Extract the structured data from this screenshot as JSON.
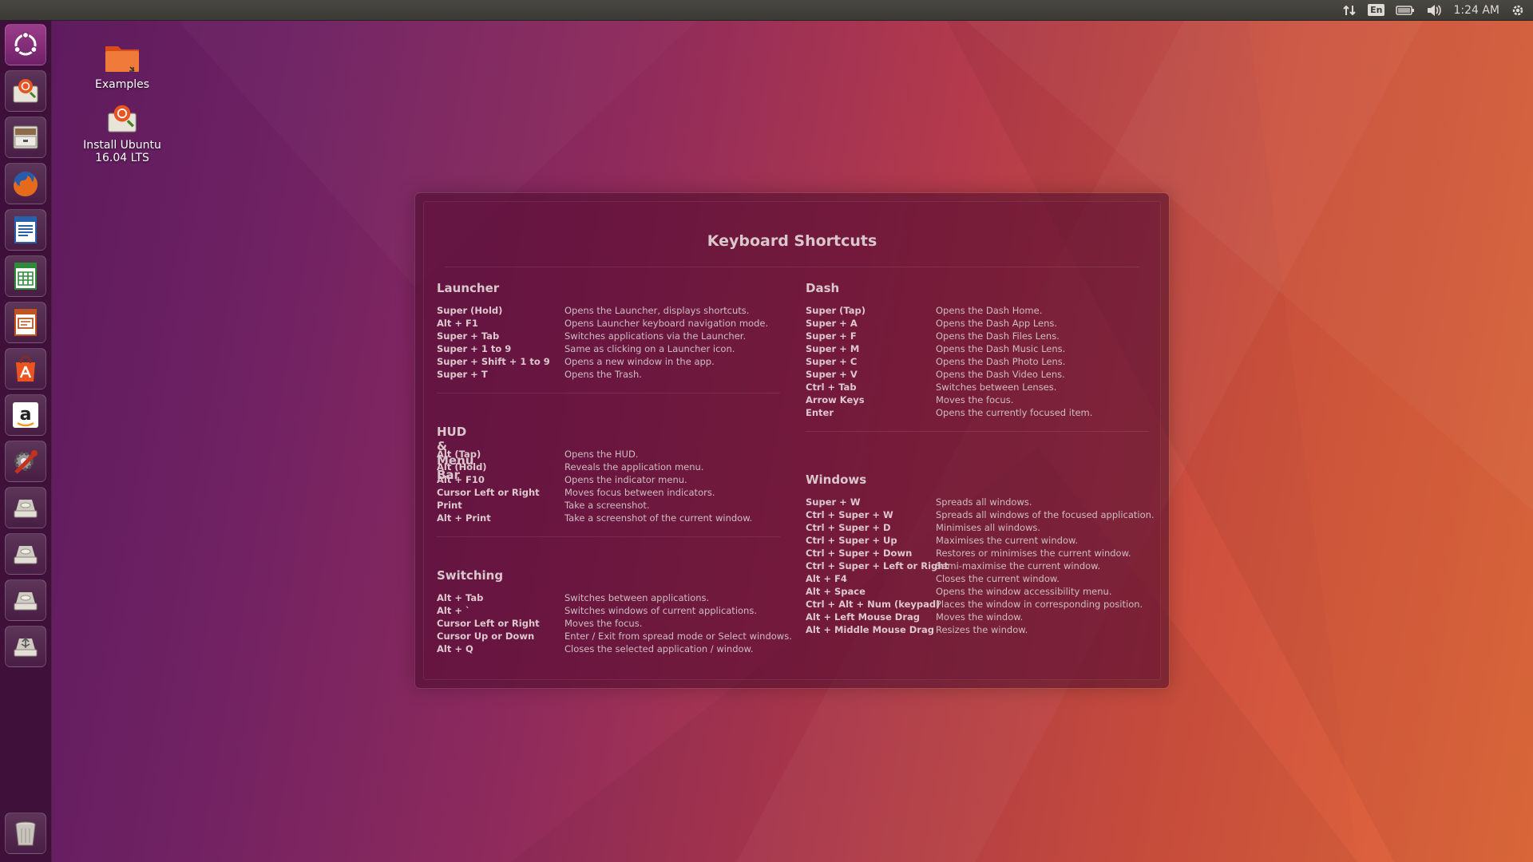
{
  "top_panel": {
    "keyboard_layout": "En",
    "clock": "1:24 AM"
  },
  "launcher": {
    "items": [
      {
        "name": "dash-home",
        "icon": "ubuntu-logo-icon"
      },
      {
        "name": "install-ubuntu",
        "icon": "installer-icon"
      },
      {
        "name": "files",
        "icon": "file-cabinet-icon"
      },
      {
        "name": "firefox",
        "icon": "firefox-icon"
      },
      {
        "name": "libreoffice-writer",
        "icon": "writer-icon"
      },
      {
        "name": "libreoffice-calc",
        "icon": "calc-icon"
      },
      {
        "name": "libreoffice-impress",
        "icon": "impress-icon"
      },
      {
        "name": "ubuntu-software",
        "icon": "software-center-icon"
      },
      {
        "name": "amazon",
        "icon": "amazon-icon"
      },
      {
        "name": "system-settings",
        "icon": "settings-icon"
      },
      {
        "name": "drive-1",
        "icon": "drive-icon"
      },
      {
        "name": "drive-2",
        "icon": "drive-icon"
      },
      {
        "name": "drive-3",
        "icon": "drive-icon"
      },
      {
        "name": "usb-drive",
        "icon": "usb-drive-icon"
      },
      {
        "name": "trash",
        "icon": "trash-icon"
      }
    ]
  },
  "desktop": {
    "icons": [
      {
        "label": "Examples",
        "icon": "folder-icon"
      },
      {
        "label": "Install Ubuntu 16.04 LTS",
        "icon": "installer-icon"
      }
    ]
  },
  "overlay": {
    "title": "Keyboard Shortcuts",
    "columns": [
      {
        "sections": [
          {
            "title": "Launcher",
            "rows": [
              {
                "key": "Super (Hold)",
                "desc": "Opens the Launcher, displays shortcuts."
              },
              {
                "key": "Alt + F1",
                "desc": "Opens Launcher keyboard navigation mode."
              },
              {
                "key": "Super + Tab",
                "desc": "Switches applications via the Launcher."
              },
              {
                "key": "Super + 1 to 9",
                "desc": "Same as clicking on a Launcher icon."
              },
              {
                "key": "Super + Shift + 1 to 9",
                "desc": "Opens a new window in the app."
              },
              {
                "key": "Super + T",
                "desc": "Opens the Trash."
              }
            ]
          },
          {
            "title": "HUD & Menu Bar",
            "rows": [
              {
                "key": "Alt (Tap)",
                "desc": "Opens the HUD."
              },
              {
                "key": "Alt (Hold)",
                "desc": "Reveals the application menu."
              },
              {
                "key": "Alt + F10",
                "desc": "Opens the indicator menu."
              },
              {
                "key": "Cursor Left or Right",
                "desc": "Moves focus between indicators."
              },
              {
                "key": "Print",
                "desc": "Take a screenshot."
              },
              {
                "key": "Alt + Print",
                "desc": "Take a screenshot of the current window."
              }
            ]
          },
          {
            "title": "Switching",
            "rows": [
              {
                "key": "Alt + Tab",
                "desc": "Switches between applications."
              },
              {
                "key": "Alt + `",
                "desc": "Switches windows of current applications."
              },
              {
                "key": "Cursor Left or Right",
                "desc": "Moves the focus."
              },
              {
                "key": "Cursor Up or Down",
                "desc": "Enter / Exit from spread mode or Select windows."
              },
              {
                "key": "Alt + Q",
                "desc": "Closes the selected application / window."
              }
            ]
          }
        ]
      },
      {
        "sections": [
          {
            "title": "Dash",
            "rows": [
              {
                "key": "Super (Tap)",
                "desc": "Opens the Dash Home."
              },
              {
                "key": "Super + A",
                "desc": "Opens the Dash App Lens."
              },
              {
                "key": "Super + F",
                "desc": "Opens the Dash Files Lens."
              },
              {
                "key": "Super + M",
                "desc": "Opens the Dash Music Lens."
              },
              {
                "key": "Super + C",
                "desc": "Opens the Dash Photo Lens."
              },
              {
                "key": "Super + V",
                "desc": "Opens the Dash Video Lens."
              },
              {
                "key": "Ctrl + Tab",
                "desc": "Switches between Lenses."
              },
              {
                "key": "Arrow Keys",
                "desc": "Moves the focus."
              },
              {
                "key": "Enter",
                "desc": "Opens the currently focused item."
              }
            ]
          },
          {
            "title": "Windows",
            "rows": [
              {
                "key": "Super + W",
                "desc": "Spreads all windows."
              },
              {
                "key": "Ctrl + Super + W",
                "desc": "Spreads all windows of the focused application."
              },
              {
                "key": "Ctrl + Super + D",
                "desc": "Minimises all windows."
              },
              {
                "key": "Ctrl + Super + Up",
                "desc": "Maximises the current window."
              },
              {
                "key": "Ctrl + Super + Down",
                "desc": "Restores or minimises the current window."
              },
              {
                "key": "Ctrl + Super + Left or Right",
                "desc": "Semi-maximise the current window."
              },
              {
                "key": "Alt + F4",
                "desc": "Closes the current window."
              },
              {
                "key": "Alt + Space",
                "desc": "Opens the window accessibility menu."
              },
              {
                "key": "Ctrl + Alt + Num (keypad)",
                "desc": "Places the window in corresponding position."
              },
              {
                "key": "Alt + Left Mouse Drag",
                "desc": "Moves the window."
              },
              {
                "key": "Alt + Middle Mouse Drag",
                "desc": "Resizes the window."
              }
            ]
          }
        ]
      }
    ]
  }
}
